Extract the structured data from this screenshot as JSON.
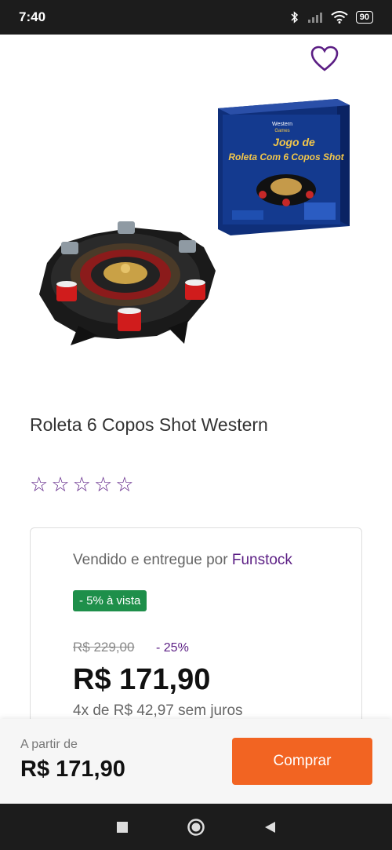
{
  "status": {
    "time": "7:40",
    "battery": "90"
  },
  "product": {
    "box_brand": "Western",
    "box_sub": "Games",
    "box_title_1": "Jogo de",
    "box_title_2": "Roleta Com 6 Copos Shot",
    "title": "Roleta 6 Copos Shot Western",
    "rating_stars": 0,
    "rating_max": 5
  },
  "offer": {
    "seller_prefix": "Vendido e entregue por ",
    "seller_name": "Funstock",
    "badge": "- 5% à vista",
    "old_price": "R$ 229,00",
    "discount": "- 25%",
    "price": "R$ 171,90",
    "installments": "4x de R$ 42,97 sem juros"
  },
  "buybar": {
    "from_label": "A partir de",
    "from_price": "R$ 171,90",
    "buy_label": "Comprar"
  },
  "colors": {
    "accent": "#5b1e84",
    "buy": "#f26422",
    "badge": "#1e8f4a"
  }
}
